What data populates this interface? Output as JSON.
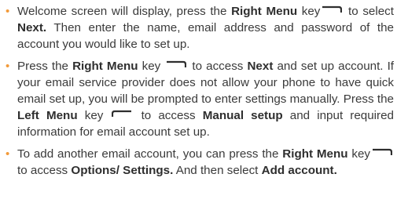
{
  "bullets": [
    {
      "parts": {
        "t1": "Welcome screen will display, press the ",
        "b1": "Right Menu",
        "t2": " key",
        "t3": " to select ",
        "b2": "Next.",
        "t4": " Then enter the name, email address and password of the account you would like to set up."
      },
      "key_icon": "right-menu-key-icon"
    },
    {
      "parts": {
        "t1": "Press the ",
        "b1": "Right Menu",
        "t2": " key ",
        "t3": " to access ",
        "b2": "Next",
        "t4": " and set up account. If your email service provider does not allow your phone to have quick email set up, you will be prompted to enter settings manually. Press the ",
        "b3": "Left Menu",
        "t5": " key ",
        "t6": " to access ",
        "b4": "Manual setup",
        "t7": " and input required information for email account set up."
      },
      "key_icons": [
        "right-menu-key-icon",
        "left-menu-key-icon"
      ]
    },
    {
      "parts": {
        "t1": "To add another email account, you can press the ",
        "b1": "Right Menu",
        "t2": " key",
        "t3": "to access ",
        "b2": "Options/ Settings.",
        "t4": " And then select ",
        "b3": "Add account."
      },
      "key_icon": "right-menu-key-icon"
    }
  ],
  "colors": {
    "bullet": "#f29a3a",
    "text": "#3a3a3a"
  }
}
